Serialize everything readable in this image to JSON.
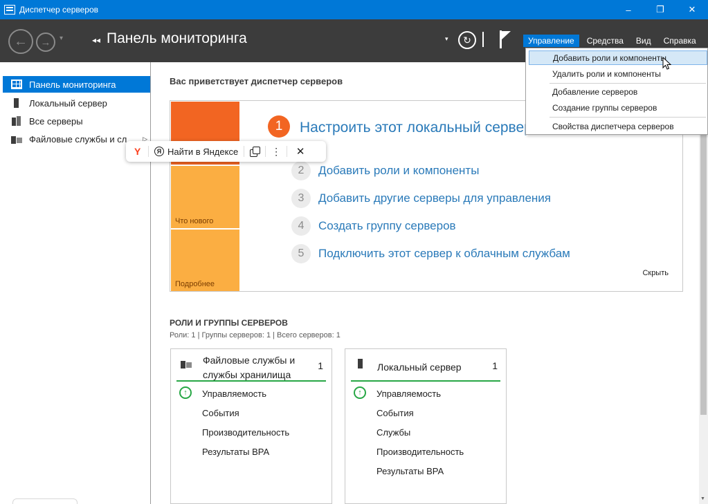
{
  "window": {
    "title": "Диспетчер серверов",
    "minimize": "–",
    "restore": "❐",
    "close": "✕"
  },
  "header": {
    "back": "←",
    "forward": "→",
    "nav_dropdown": "▾",
    "breadcrumb_arrows": "◂◂",
    "title": "Панель мониторинга",
    "dropdown": "▾",
    "refresh": "↻"
  },
  "menubar": {
    "items": [
      "Управление",
      "Средства",
      "Вид",
      "Справка"
    ],
    "active_index": 0
  },
  "sidebar": {
    "items": [
      {
        "label": "Панель мониторинга"
      },
      {
        "label": "Локальный сервер"
      },
      {
        "label": "Все серверы"
      },
      {
        "label": "Файловые службы и сл"
      }
    ],
    "expand_arrow": "▷"
  },
  "welcome": {
    "title": "Вас приветствует диспетчер серверов",
    "tiles": {
      "whats_new": "Что нового",
      "more": "Подробнее"
    },
    "steps": [
      {
        "num": "1",
        "label": "Настроить этот локальный сервер"
      },
      {
        "num": "2",
        "label": "Добавить роли и компоненты"
      },
      {
        "num": "3",
        "label": "Добавить другие серверы для управления"
      },
      {
        "num": "4",
        "label": "Создать группу серверов"
      },
      {
        "num": "5",
        "label": "Подключить этот сервер к облачным службам"
      }
    ],
    "hide": "Скрыть"
  },
  "roles": {
    "title": "РОЛИ И ГРУППЫ СЕРВЕРОВ",
    "subtitle": "Роли: 1 | Группы серверов: 1 | Всего серверов: 1",
    "cards": [
      {
        "title": "Файловые службы и службы хранилища",
        "count": "1",
        "rows": [
          "Управляемость",
          "События",
          "Производительность",
          "Результаты BPA"
        ]
      },
      {
        "title": "Локальный сервер",
        "count": "1",
        "rows": [
          "Управляемость",
          "События",
          "Службы",
          "Производительность",
          "Результаты BPA"
        ]
      }
    ],
    "ok_glyph": "↑"
  },
  "yandex": {
    "logo": "Y",
    "ya": "Я",
    "search": "Найти в Яндексе",
    "more": "⋮",
    "close": "✕"
  },
  "dropdown_menu": {
    "items": [
      "Добавить роли и компоненты",
      "Удалить роли и компоненты",
      "Добавление серверов",
      "Создание группы серверов",
      "Свойства диспетчера серверов"
    ],
    "hover_index": 0
  },
  "colors": {
    "accent": "#0078d7",
    "header": "#3c3c3c",
    "tile_orange": "#f26522",
    "tile_yellow": "#fbae42",
    "link": "#2a7ab9",
    "ok_green": "#27a745"
  },
  "icons": [
    "back-icon",
    "forward-icon",
    "refresh-icon",
    "flag-icon",
    "dashboard-grid-icon",
    "server-icon",
    "servers-icon",
    "file-services-icon",
    "status-ok-icon",
    "copy-icon",
    "close-icon",
    "cursor-icon"
  ]
}
